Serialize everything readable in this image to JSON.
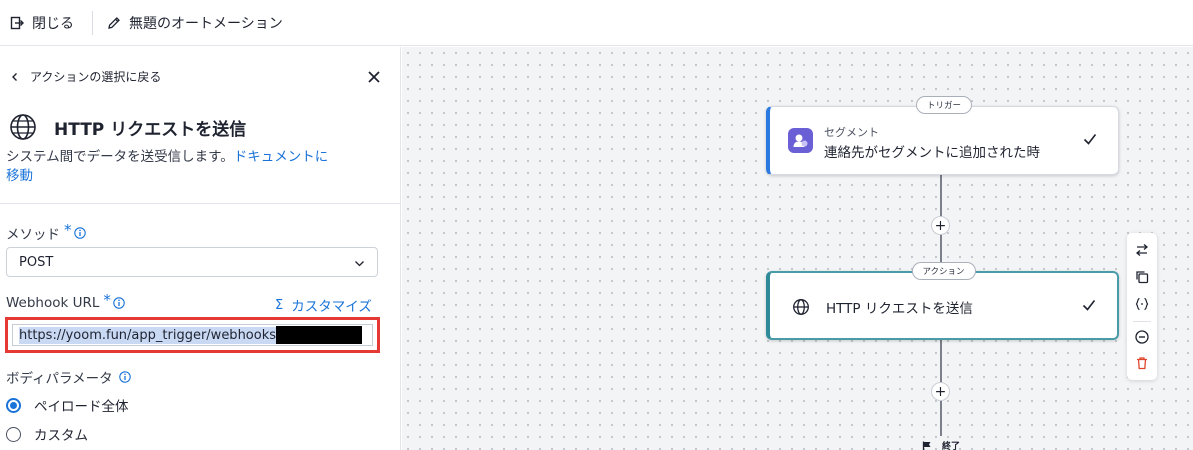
{
  "topbar": {
    "close_label": "閉じる",
    "automation_title": "無題のオートメーション"
  },
  "panel": {
    "back_label": "アクションの選択に戻る",
    "action_title": "HTTP リクエストを送信",
    "description": "システム間でデータを送受信します。",
    "doc_link_line1": "ドキュメントに",
    "doc_link_line2": "移動",
    "method": {
      "label": "メソッド",
      "required_mark": "*",
      "value": "POST"
    },
    "webhook": {
      "label": "Webhook URL",
      "required_mark": "*",
      "customize_symbol": "Σ",
      "customize_label": "カスタマイズ",
      "value": "https://yoom.fun/app_trigger/webhooks"
    },
    "body_params": {
      "label": "ボディパラメータ",
      "options": [
        {
          "label": "ペイロード全体",
          "checked": true
        },
        {
          "label": "カスタム",
          "checked": false
        }
      ]
    }
  },
  "canvas": {
    "trigger_node": {
      "tag": "トリガー",
      "subtitle": "セグメント",
      "title": "連絡先がセグメントに追加された時"
    },
    "action_node": {
      "tag": "アクション",
      "title": "HTTP リクエストを送信"
    },
    "add_symbol": "+",
    "end_label": "終了"
  },
  "colors": {
    "accent": "#1a73d8",
    "highlight_border": "#e53935",
    "trigger_border": "#2a7ae2",
    "action_border": "#2e8a99",
    "segment_icon_bg": "#6b5fd6",
    "delete_icon": "#e0452b"
  }
}
